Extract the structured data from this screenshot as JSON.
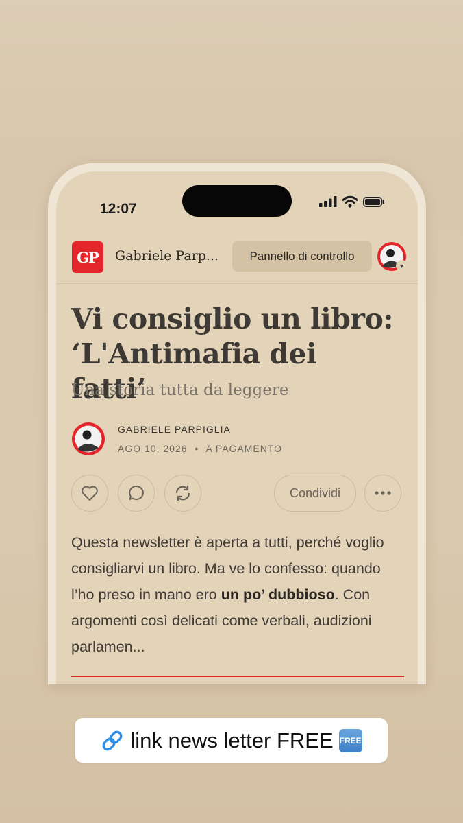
{
  "status_bar": {
    "time": "12:07"
  },
  "header": {
    "logo_text": "GP",
    "publication_name": "Gabriele Parp...",
    "dashboard_label": "Pannello di controllo"
  },
  "post": {
    "title": "Vi consiglio un libro: ‘L'Antimafia dei fatti’",
    "subtitle": "Una storia tutta da leggere",
    "author": "GABRIELE PARPIGLIA",
    "date": "AGO 10, 2026",
    "separator": "•",
    "access": "A PAGAMENTO",
    "body_part1": "Questa newsletter è aperta a tutti, perché voglio consigliarvi un libro. Ma ve lo confesso: quando l’ho preso in mano ero ",
    "body_bold": "un po’ dubbioso",
    "body_part2": ". Con argomenti così delicati come verbali, audizioni parlamen..."
  },
  "actions": {
    "share_label": "Condividi",
    "icons": [
      "heart-icon",
      "comment-icon",
      "restack-icon",
      "more-icon"
    ]
  },
  "story_sticker": {
    "text": "link news letter FREE",
    "badge_text": "FREE"
  },
  "colors": {
    "background": "#dccdb6",
    "screen": "#e3d3b8",
    "accent_red": "#e3262b",
    "text": "#3d3934"
  }
}
